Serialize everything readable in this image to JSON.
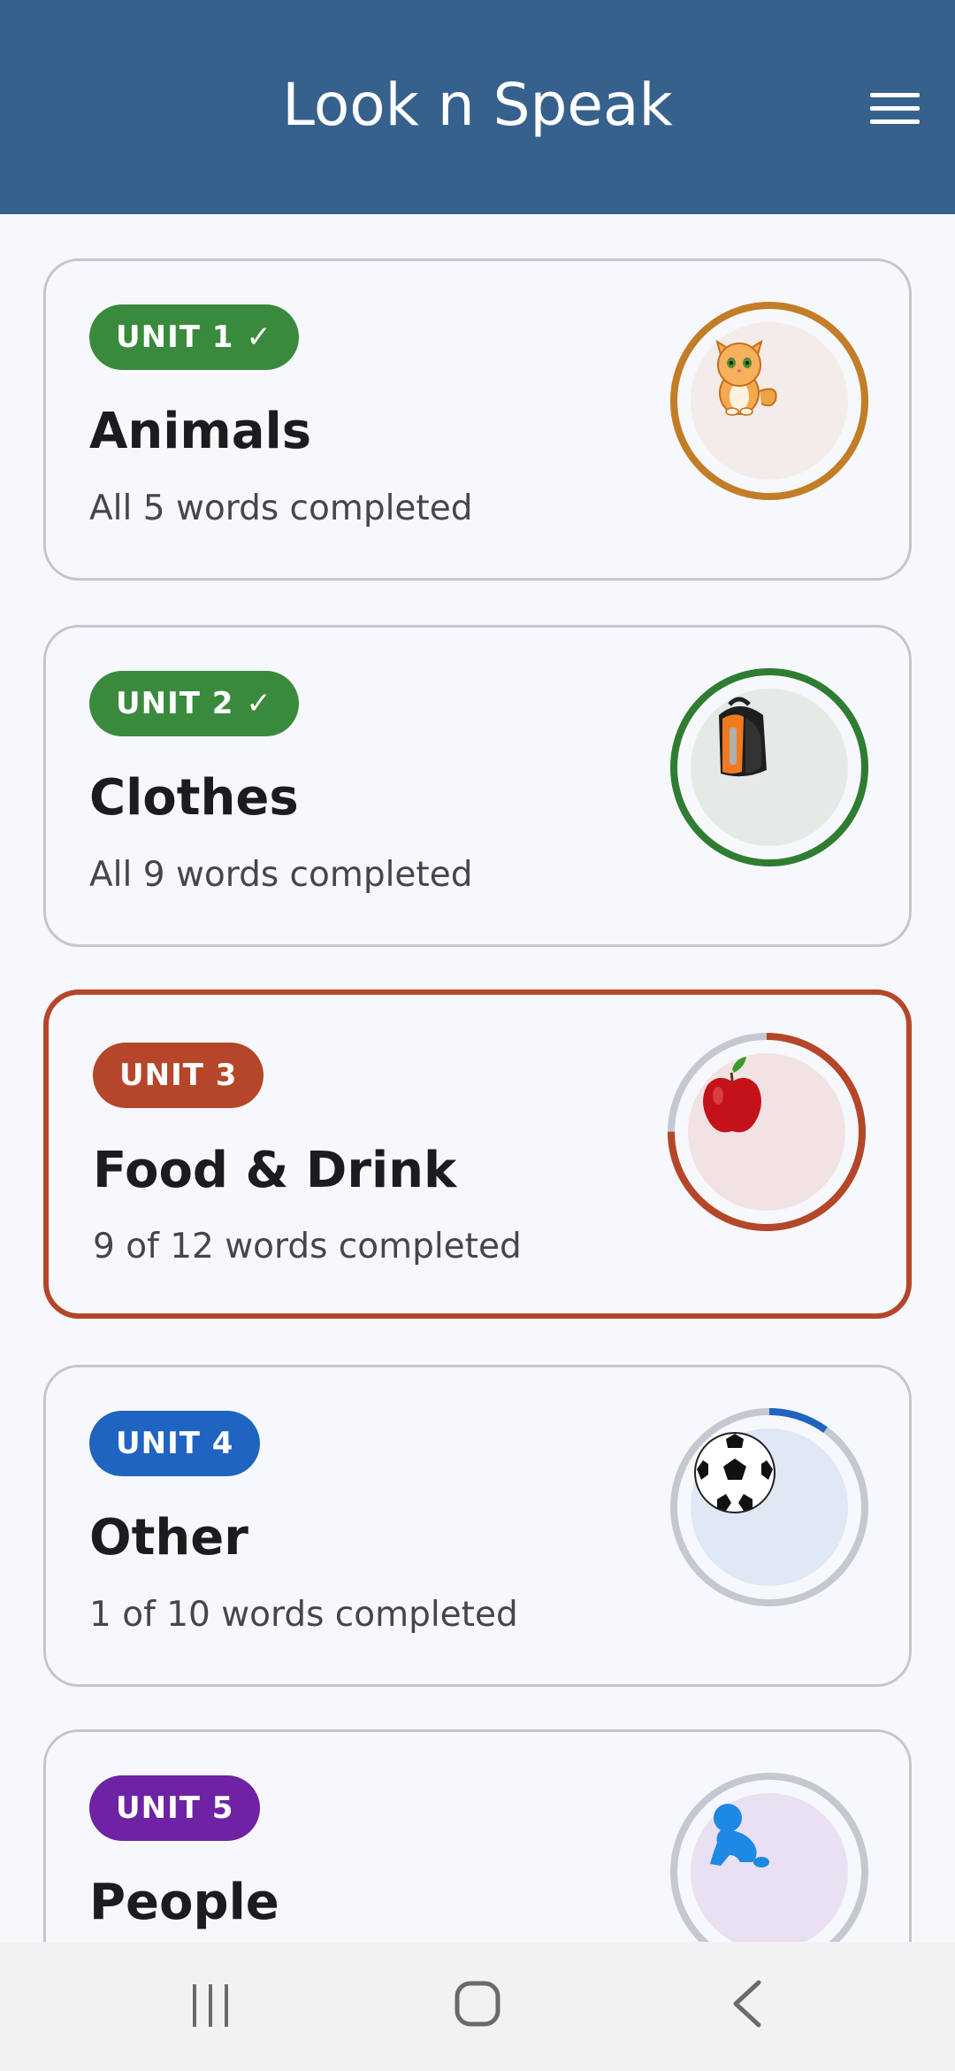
{
  "app": {
    "title": "Look n Speak",
    "menu_icon": "hamburger-menu-icon"
  },
  "units": [
    {
      "badge": "UNIT 1",
      "completed": true,
      "title": "Animals",
      "subtitle": "All 5 words completed",
      "progress": 1.0,
      "color": "#3a8a3d",
      "ring_color": "#c37d27",
      "inner_bg": "#f3ece8",
      "icon": "cat-icon"
    },
    {
      "badge": "UNIT 2",
      "completed": true,
      "title": "Clothes",
      "subtitle": "All 9 words completed",
      "progress": 1.0,
      "color": "#3a8a3d",
      "ring_color": "#2f7d32",
      "inner_bg": "#e4ebe6",
      "icon": "backpack-icon"
    },
    {
      "badge": "UNIT 3",
      "completed": false,
      "current": true,
      "title": "Food & Drink",
      "subtitle": "9 of 12 words completed",
      "progress": 0.75,
      "color": "#b5462a",
      "ring_color": "#b5462a",
      "inner_bg": "#f1e3e3",
      "icon": "apple-icon"
    },
    {
      "badge": "UNIT 4",
      "completed": false,
      "title": "Other",
      "subtitle": "1 of 10 words completed",
      "progress": 0.1,
      "color": "#1f64c0",
      "ring_color": "#1f64c0",
      "inner_bg": "#e0e7f5",
      "icon": "soccer-ball-icon"
    },
    {
      "badge": "UNIT 5",
      "completed": false,
      "title": "People",
      "subtitle": "",
      "progress": 0.0,
      "color": "#6d23a3",
      "ring_color": "#6d23a3",
      "inner_bg": "#e9e0f1",
      "icon": "baby-icon"
    }
  ],
  "colors": {
    "header": "#37618d",
    "ring_track": "#c4c8d0"
  },
  "nav": {
    "recent_icon": "recent-apps-icon",
    "home_icon": "home-icon",
    "back_icon": "back-icon"
  }
}
